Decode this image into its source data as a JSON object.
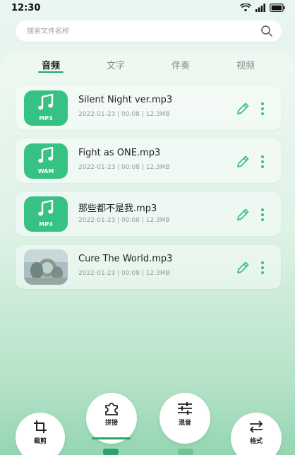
{
  "status_bar": {
    "time": "12:30",
    "icons": [
      "wifi-icon",
      "signal-icon",
      "battery-icon"
    ]
  },
  "search": {
    "placeholder": "搜索文件名称",
    "icon": "search-icon"
  },
  "tabs": [
    {
      "label": "音频",
      "active": true
    },
    {
      "label": "文字",
      "active": false
    },
    {
      "label": "伴奏",
      "active": false
    },
    {
      "label": "视频",
      "active": false
    }
  ],
  "files": [
    {
      "name": "Silent Night ver.mp3",
      "meta": "2022-01-23 | 00:08 | 12.3MB",
      "thumb_format": "MP3",
      "thumb_type": "note"
    },
    {
      "name": "Fight as ONE.mp3",
      "meta": "2022-01-23 | 00:08 | 12.3MB",
      "thumb_format": "WAM",
      "thumb_type": "note"
    },
    {
      "name": "那些都不是我.mp3",
      "meta": "2022-01-23 | 00:08 | 12.3MB",
      "thumb_format": "MP3",
      "thumb_type": "note"
    },
    {
      "name": "Cure The World.mp3",
      "meta": "2022-01-23 | 00:08 | 12.3MB",
      "thumb_format": "",
      "thumb_type": "photo"
    }
  ],
  "tools": {
    "crop": {
      "label": "裁剪",
      "icon": "crop-icon"
    },
    "splice": {
      "label": "拼接",
      "icon": "puzzle-icon"
    },
    "mix": {
      "label": "混音",
      "icon": "sliders-icon"
    },
    "format": {
      "label": "格式",
      "icon": "swap-arrows-icon"
    }
  },
  "colors": {
    "accent": "#35c283",
    "accent_dark": "#2aa36a",
    "icon_green": "#3cbf82"
  }
}
